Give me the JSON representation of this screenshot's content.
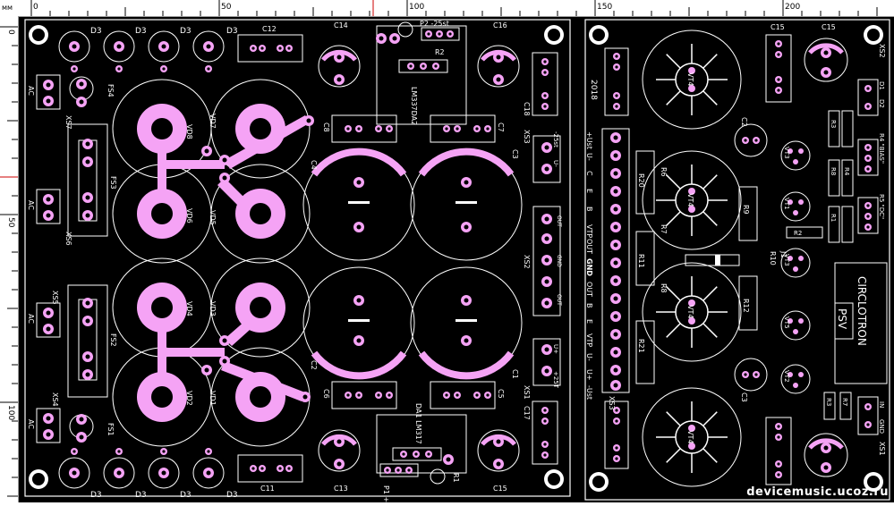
{
  "ruler": {
    "unit": "мм",
    "x_ticks": [
      "0",
      "50",
      "100",
      "150",
      "200"
    ],
    "y_ticks": [
      "0",
      "50",
      "100"
    ]
  },
  "colors": {
    "board_bg": "#000000",
    "copper": "#f5a3f5",
    "outline": "#ffffff",
    "ruler_marker": "#cc0000"
  },
  "left_board": {
    "big_diodes": [
      "VD8",
      "VD7",
      "VD6",
      "VD5",
      "VD4",
      "VD3",
      "VD2",
      "VD1"
    ],
    "small_diodes_top": [
      "D3",
      "D3",
      "D3",
      "D3"
    ],
    "small_diodes_bottom": [
      "D3",
      "D3",
      "D3",
      "D3"
    ],
    "fuse_holders": [
      "FS3",
      "FS2"
    ],
    "fuses": [
      "FS4",
      "FS1"
    ],
    "connectors": [
      "XS7",
      "XS6",
      "XS5",
      "XS4"
    ],
    "ac_label": "AC",
    "big_caps": [
      "C4",
      "C3",
      "C2",
      "C1"
    ],
    "film_caps": [
      "C12",
      "C11",
      "C8",
      "C7",
      "C6",
      "C5",
      "C18",
      "C17"
    ],
    "elec_caps": [
      "C14",
      "C16",
      "C13",
      "C15"
    ],
    "regulators": [
      "LM337DA2",
      "DA1 LM317"
    ],
    "pots": [
      "P2 -25st",
      "P1 +12ST"
    ],
    "resistors": [
      "R2",
      "R1"
    ],
    "xs3_pins": [
      "-25st",
      "U-"
    ],
    "xs2_pins": [
      "OUT",
      "GND",
      "OUT"
    ],
    "xs1_pins": [
      "U+",
      "+25T"
    ],
    "net_labels": [
      "XS3",
      "XS2",
      "XS1"
    ]
  },
  "right_board": {
    "year": "2018",
    "pin_strip": [
      "+Ust",
      "U-",
      "C",
      "E",
      "B",
      "VTP",
      "OUT",
      "GND",
      "OUT",
      "B",
      "E",
      "VTP",
      "U-",
      "U+",
      "-Ust"
    ],
    "power_transistors": [
      "VT4",
      "VT4",
      "VT4",
      "VT4"
    ],
    "small_transistors": [
      "VT3",
      "VT1",
      "VT3",
      "VT5",
      "VT2"
    ],
    "resistors": [
      "R20",
      "R6",
      "R7",
      "R8",
      "R11",
      "R9",
      "R12",
      "R21",
      "R10",
      "R3",
      "R1",
      "R8",
      "R4",
      "R2",
      "R3",
      "R7"
    ],
    "caps": [
      "C15",
      "C15",
      "C2",
      "C3",
      "C1"
    ],
    "labels": [
      "D1",
      "D2",
      "XS2",
      "R4 \"BIAS\"",
      "R5 \"DC\"",
      "XS3",
      "XS1",
      "IN",
      "GND",
      "J1"
    ],
    "brand": "CIRCLOTRON",
    "brand_sub": "PSV"
  },
  "watermark": "devicemusic.ucoz.ru"
}
